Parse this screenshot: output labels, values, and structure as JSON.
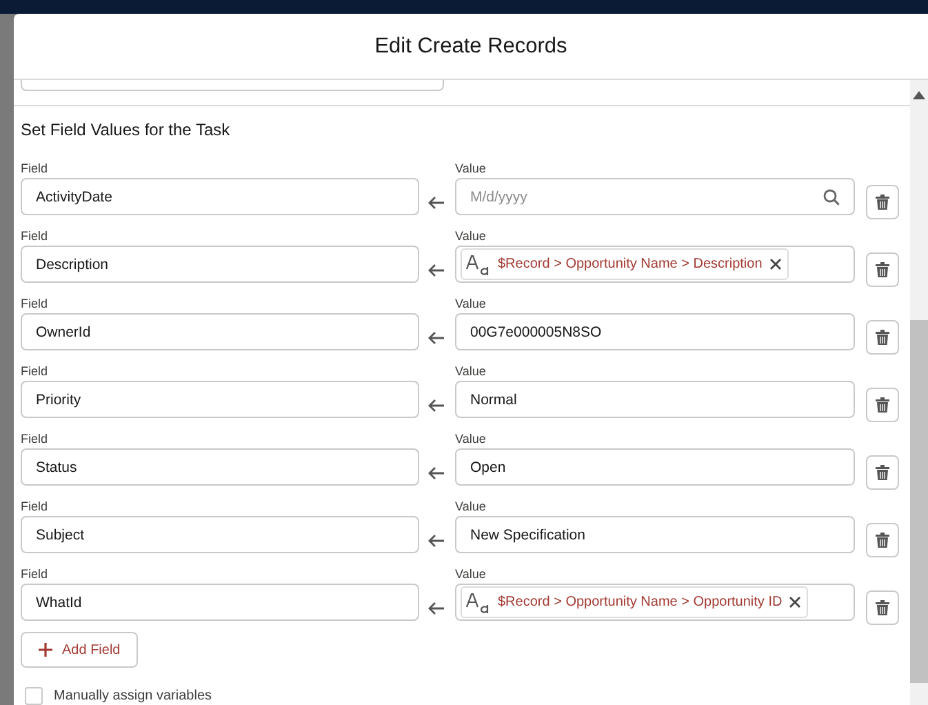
{
  "modal": {
    "title": "Edit Create Records"
  },
  "section": {
    "title": "Set Field Values for the Task"
  },
  "assignments": [
    {
      "field_label": "Field",
      "field": "ActivityDate",
      "value_label": "Value",
      "kind": "date",
      "placeholder": "M/d/yyyy"
    },
    {
      "field_label": "Field",
      "field": "Description",
      "value_label": "Value",
      "kind": "resource",
      "value": "$Record > Opportunity Name > Description"
    },
    {
      "field_label": "Field",
      "field": "OwnerId",
      "value_label": "Value",
      "kind": "text",
      "value": "00G7e000005N8SO"
    },
    {
      "field_label": "Field",
      "field": "Priority",
      "value_label": "Value",
      "kind": "text",
      "value": "Normal"
    },
    {
      "field_label": "Field",
      "field": "Status",
      "value_label": "Value",
      "kind": "text",
      "value": "Open"
    },
    {
      "field_label": "Field",
      "field": "Subject",
      "value_label": "Value",
      "kind": "text",
      "value": "New Specification"
    },
    {
      "field_label": "Field",
      "field": "WhatId",
      "value_label": "Value",
      "kind": "resource",
      "value": "$Record > Opportunity Name > Opportunity ID"
    }
  ],
  "add_button": {
    "label": "Add Field"
  },
  "manual_assign": {
    "label": "Manually assign variables",
    "checked": false
  }
}
